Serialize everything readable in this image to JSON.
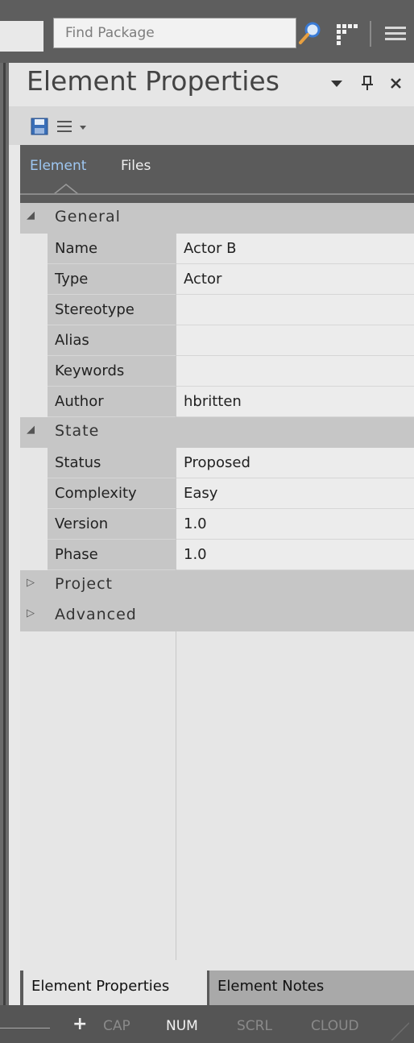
{
  "search": {
    "placeholder": "Find Package"
  },
  "panel": {
    "title": "Element Properties",
    "tabs": [
      {
        "label": "Element",
        "active": true
      },
      {
        "label": "Files",
        "active": false
      }
    ],
    "groups": [
      {
        "label": "General",
        "expanded": true,
        "properties": [
          {
            "name": "Name",
            "value": "Actor B"
          },
          {
            "name": "Type",
            "value": "Actor"
          },
          {
            "name": "Stereotype",
            "value": ""
          },
          {
            "name": "Alias",
            "value": ""
          },
          {
            "name": "Keywords",
            "value": ""
          },
          {
            "name": "Author",
            "value": "hbritten"
          }
        ]
      },
      {
        "label": "State",
        "expanded": true,
        "properties": [
          {
            "name": "Status",
            "value": "Proposed"
          },
          {
            "name": "Complexity",
            "value": "Easy"
          },
          {
            "name": "Version",
            "value": "1.0"
          },
          {
            "name": "Phase",
            "value": "1.0"
          }
        ]
      },
      {
        "label": "Project",
        "expanded": false,
        "properties": []
      },
      {
        "label": "Advanced",
        "expanded": false,
        "properties": []
      }
    ]
  },
  "bottom_tabs": [
    {
      "label": "Element Properties",
      "active": true
    },
    {
      "label": "Element Notes",
      "active": false
    }
  ],
  "statusbar": {
    "plus": "+",
    "cap": "CAP",
    "num": "NUM",
    "scrl": "SCRL",
    "cloud": "CLOUD"
  },
  "colors": {
    "accent_tab": "#9ec7f2",
    "header_bg": "#5b5b5b",
    "group_bg": "#c6c6c6"
  }
}
